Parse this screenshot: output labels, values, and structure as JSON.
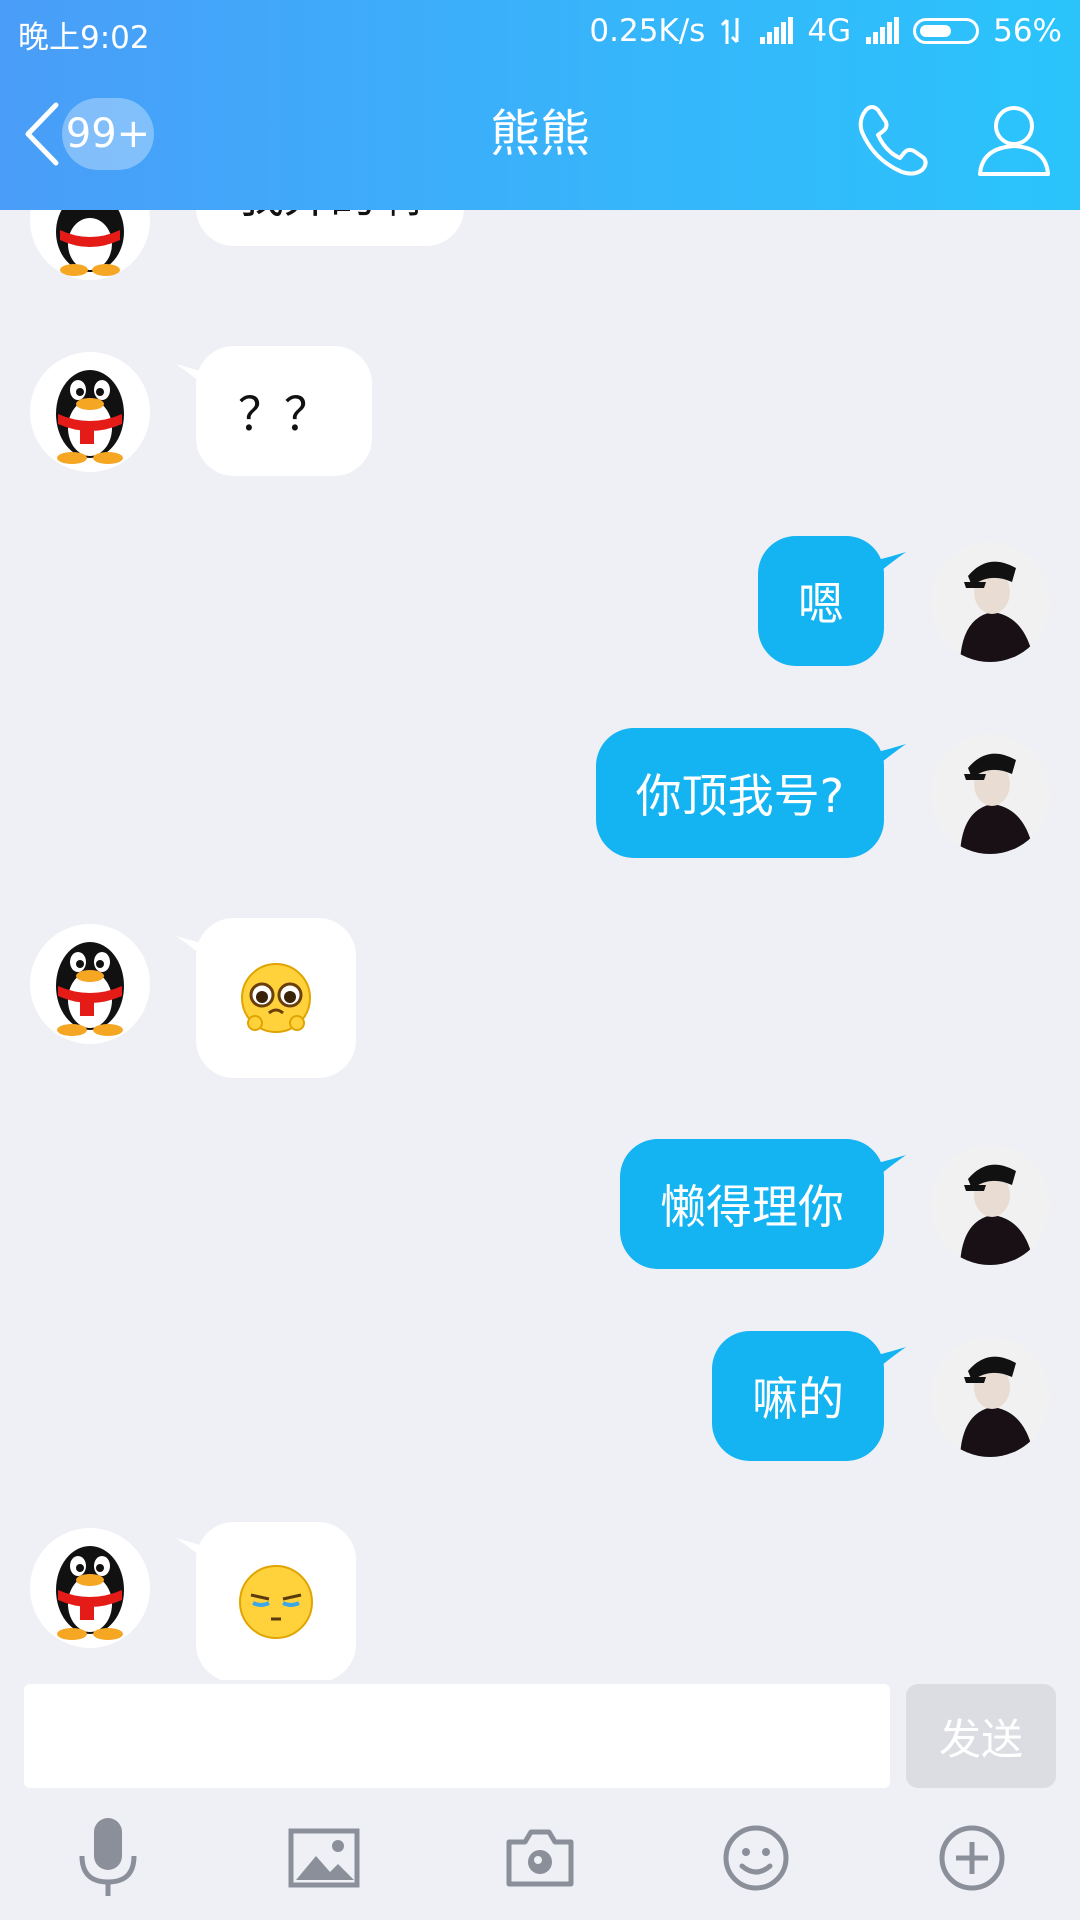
{
  "status_bar": {
    "time": "晚上9:02",
    "net_speed": "0.25K/s",
    "network": "4G",
    "battery": "56%",
    "battery_level": 0.56
  },
  "header": {
    "back_icon": "chevron-left-icon",
    "unread_count": "99+",
    "title": "熊熊",
    "call_icon": "phone-icon",
    "profile_icon": "user-icon",
    "gradient": [
      "#4a9df8",
      "#2ac4fb"
    ]
  },
  "messages": [
    {
      "side": "in",
      "type": "text",
      "text": "我弄的啊"
    },
    {
      "side": "in",
      "type": "text",
      "text": "？？"
    },
    {
      "side": "out",
      "type": "text",
      "text": "嗯"
    },
    {
      "side": "out",
      "type": "text",
      "text": "你顶我号?"
    },
    {
      "side": "in",
      "type": "emoji",
      "emoji": "pitiful-face-emoji"
    },
    {
      "side": "out",
      "type": "text",
      "text": "懒得理你"
    },
    {
      "side": "out",
      "type": "text",
      "text": "嘛的"
    },
    {
      "side": "in",
      "type": "emoji",
      "emoji": "smug-face-emoji"
    }
  ],
  "input": {
    "value": "",
    "placeholder": "",
    "send_label": "发送"
  },
  "toolbar": {
    "icons": [
      "microphone-icon",
      "image-icon",
      "camera-icon",
      "smiley-icon",
      "plus-circle-icon"
    ]
  },
  "colors": {
    "outgoing_bubble": "#14b4f2",
    "incoming_bubble": "#ffffff",
    "background": "#eff0f6"
  }
}
